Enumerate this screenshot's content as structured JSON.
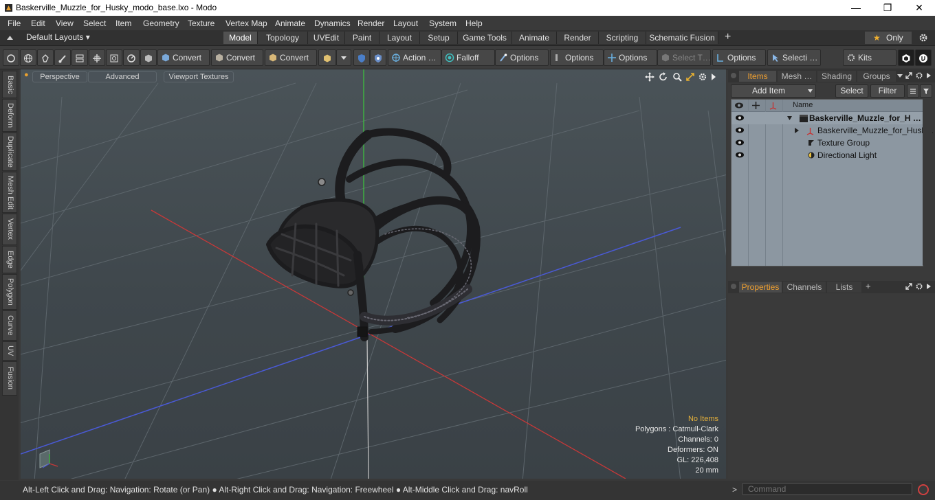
{
  "window": {
    "title": "Baskerville_Muzzle_for_Husky_modo_base.lxo - Modo",
    "minimize": "—",
    "maximize": "❐",
    "close": "✕"
  },
  "menu": [
    "File",
    "Edit",
    "View",
    "Select",
    "Item",
    "Geometry",
    "Texture",
    "Vertex Map",
    "Animate",
    "Dynamics",
    "Render",
    "Layout",
    "System",
    "Help"
  ],
  "layouts": {
    "label": "Default Layouts ▾"
  },
  "tabs": [
    {
      "label": "Model",
      "active": true
    },
    {
      "label": "Topology"
    },
    {
      "label": "UVEdit"
    },
    {
      "label": "Paint"
    },
    {
      "label": "Layout"
    },
    {
      "label": "Setup"
    },
    {
      "label": "Game Tools"
    },
    {
      "label": "Animate"
    },
    {
      "label": "Render"
    },
    {
      "label": "Scripting"
    },
    {
      "label": "Schematic Fusion"
    }
  ],
  "tab_add": "+",
  "only": {
    "star": "★",
    "label": "Only"
  },
  "toolbar": {
    "convert1": "Convert",
    "convert2": "Convert",
    "convert3": "Convert",
    "action": "Action  …",
    "falloff": "Falloff",
    "options1": "Options",
    "options2": "Options",
    "options3": "Options",
    "select_t": "Select T…",
    "options4": "Options",
    "selecti": "Selecti …",
    "kits": "Kits"
  },
  "left_tabs": [
    "Basic",
    "Deform",
    "Duplicate",
    "Mesh Edit",
    "Vertex",
    "Edge",
    "Polygon",
    "Curve",
    "UV",
    "Fusion"
  ],
  "viewport": {
    "perspective": "Perspective",
    "advanced": "Advanced",
    "viewport_textures": "Viewport Textures",
    "stats": {
      "selection": "No Items",
      "polygons": "Polygons : Catmull-Clark",
      "channels": "Channels: 0",
      "deformers": "Deformers: ON",
      "gl": "GL: 226,408",
      "unit": "20 mm"
    }
  },
  "items_panel": {
    "tabs": [
      "Items",
      "Mesh …",
      "Shading",
      "Groups"
    ],
    "add_item": "Add Item",
    "select": "Select",
    "filter": "Filter",
    "name_header": "Name",
    "rows": [
      {
        "label": "Baskerville_Muzzle_for_H …"
      },
      {
        "label": "Baskerville_Muzzle_for_Husk…"
      },
      {
        "label": "Texture Group"
      },
      {
        "label": "Directional Light"
      }
    ]
  },
  "props_panel": {
    "tabs": [
      "Properties",
      "Channels",
      "Lists"
    ],
    "add": "+"
  },
  "status": {
    "hint": "Alt-Left Click and Drag: Navigation: Rotate (or Pan) ● Alt-Right Click and Drag: Navigation: Freewheel ● Alt-Middle Click and Drag: navRoll",
    "prompt": ">",
    "command_placeholder": "Command"
  },
  "colors": {
    "accent": "#f0a030",
    "viewport_bg": "#434b50",
    "x_axis": "#c83232",
    "y_axis": "#32c832",
    "z_axis": "#3c5adc"
  }
}
